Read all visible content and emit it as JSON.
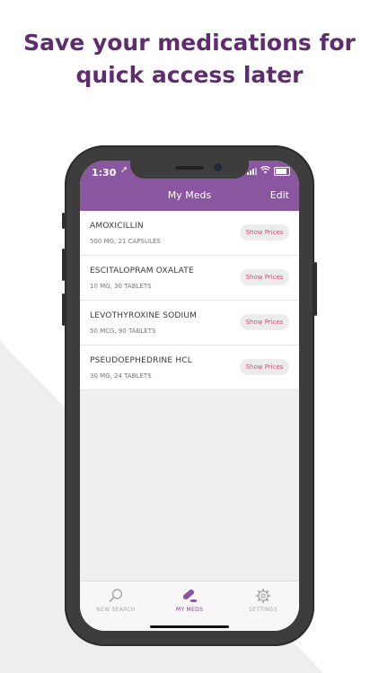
{
  "headline": {
    "line1": "Save your medications for",
    "line2": "quick access later"
  },
  "status_bar": {
    "time": "1:30"
  },
  "nav": {
    "title": "My Meds",
    "edit_label": "Edit"
  },
  "meds": [
    {
      "name": "AMOXICILLIN",
      "detail": "500 MG, 21 CAPSULES",
      "action": "Show Prices"
    },
    {
      "name": "ESCITALOPRAM OXALATE",
      "detail": "10 MG, 30 TABLETS",
      "action": "Show Prices"
    },
    {
      "name": "LEVOTHYROXINE SODIUM",
      "detail": "50 MCG, 90 TABLETS",
      "action": "Show Prices"
    },
    {
      "name": "PSEUDOEPHEDRINE HCL",
      "detail": "30 MG, 24 TABLETS",
      "action": "Show Prices"
    }
  ],
  "tabs": [
    {
      "label": "NEW SEARCH",
      "icon": "search-icon",
      "active": false
    },
    {
      "label": "MY MEDS",
      "icon": "pill-icon",
      "active": true
    },
    {
      "label": "SETTINGS",
      "icon": "gear-icon",
      "active": false
    }
  ],
  "colors": {
    "brand_purple": "#8b56a0",
    "headline_purple": "#5f2d6f",
    "price_pink": "#d64f7d"
  }
}
